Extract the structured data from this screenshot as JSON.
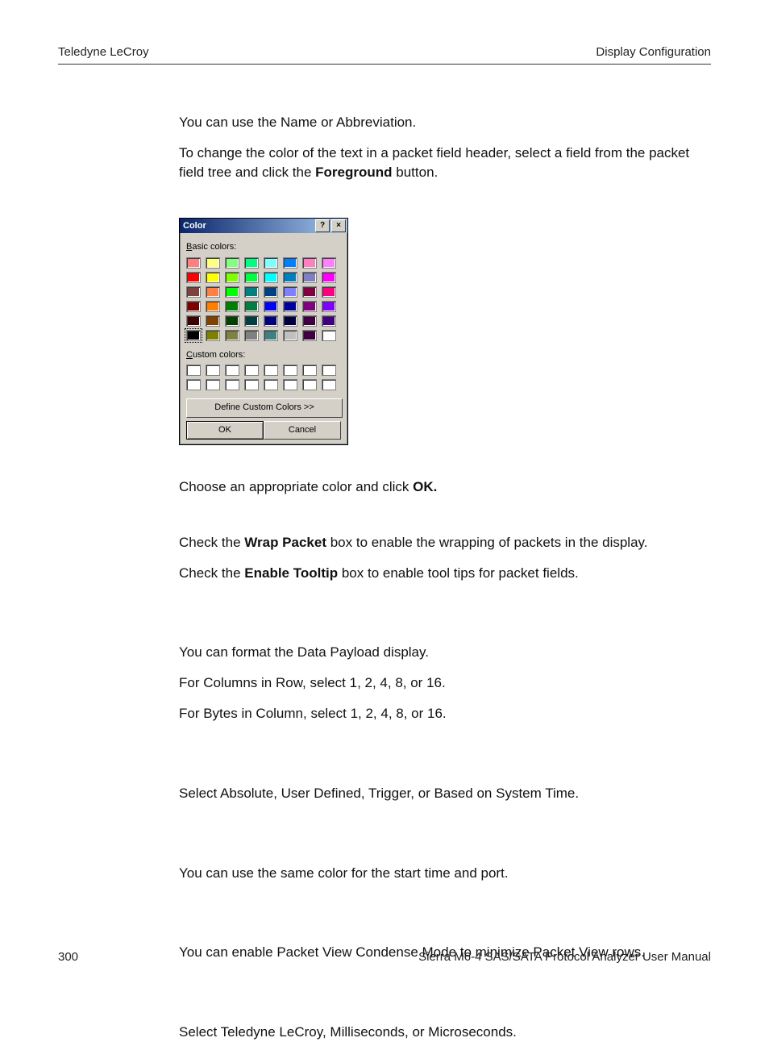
{
  "header": {
    "left": "Teledyne LeCroy",
    "right": "Display Configuration"
  },
  "paras": {
    "p1": "You can use the Name or Abbreviation.",
    "p2a": "To change the color of the text in a packet field header, select a field from the packet field tree and click the ",
    "p2b": "Foreground",
    "p2c": " button.",
    "p3a": "Choose an appropriate color and click ",
    "p3b": "OK.",
    "p4a": "Check the ",
    "p4b": "Wrap Packet",
    "p4c": " box to enable the wrapping of packets in the display.",
    "p5a": "Check the ",
    "p5b": "Enable Tooltip",
    "p5c": " box to enable tool tips for packet fields.",
    "p6": "You can format the Data Payload display.",
    "p7": "For Columns in Row, select 1, 2, 4, 8, or 16.",
    "p8": "For Bytes in Column, select 1, 2, 4, 8, or 16.",
    "p9": "Select Absolute, User Defined, Trigger, or Based on System Time.",
    "p10": "You can use the same color for the start time and port.",
    "p11": "You can enable Packet View Condense Mode to minimize Packet View rows.",
    "p12": "Select Teledyne LeCroy, Milliseconds, or Microseconds."
  },
  "dialog": {
    "title": "Color",
    "basic_label_u": "B",
    "basic_label_rest": "asic colors:",
    "custom_label_u": "C",
    "custom_label_rest": "ustom colors:",
    "define_u": "D",
    "define_rest": "efine Custom Colors >>",
    "ok": "OK",
    "cancel": "Cancel",
    "basic_colors": [
      "#ff8080",
      "#ffff80",
      "#80ff80",
      "#00ff80",
      "#80ffff",
      "#0080ff",
      "#ff80c0",
      "#ff80ff",
      "#ff0000",
      "#ffff00",
      "#80ff00",
      "#00ff40",
      "#00ffff",
      "#0080c0",
      "#8080c0",
      "#ff00ff",
      "#804040",
      "#ff8040",
      "#00ff00",
      "#008080",
      "#004080",
      "#8080ff",
      "#800040",
      "#ff0080",
      "#800000",
      "#ff8000",
      "#008000",
      "#008040",
      "#0000ff",
      "#0000a0",
      "#800080",
      "#8000ff",
      "#400000",
      "#804000",
      "#004000",
      "#004040",
      "#000080",
      "#000040",
      "#400040",
      "#400080",
      "#000000",
      "#808000",
      "#808040",
      "#808080",
      "#408080",
      "#c0c0c0",
      "#400040",
      "#ffffff"
    ],
    "selected_index": 40,
    "custom_count": 16
  },
  "footer": {
    "page": "300",
    "manual": "Sierra M6-4 SAS/SATA Protocol Analyzer User Manual"
  }
}
